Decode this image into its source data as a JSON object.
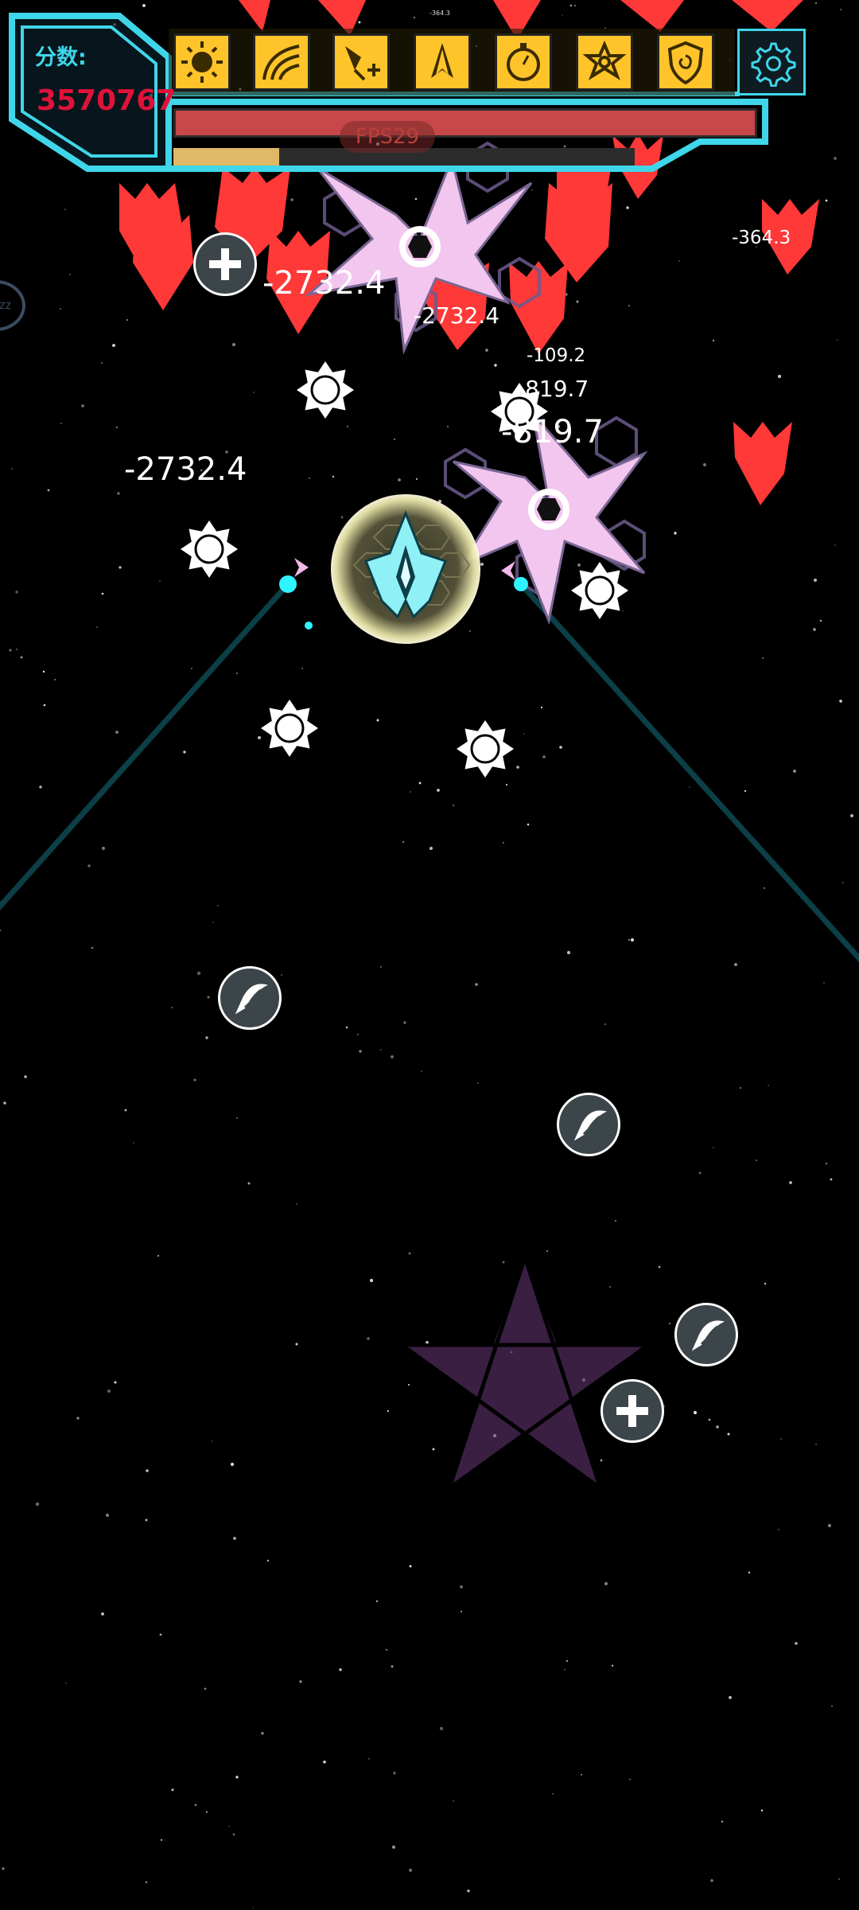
{
  "hud": {
    "score_label": "分数:",
    "score_value": "3570767",
    "fps_label": "FPS29",
    "xp_progress": 0.23,
    "skills": [
      {
        "icon": "sun-icon"
      },
      {
        "icon": "radar-sweep-icon"
      },
      {
        "icon": "drone-plus-icon"
      },
      {
        "icon": "jet-icon"
      },
      {
        "icon": "stopwatch-icon"
      },
      {
        "icon": "flower-icon"
      },
      {
        "icon": "spiral-shield-icon"
      }
    ],
    "settings_icon": "gear-icon"
  },
  "damage_numbers": [
    {
      "text": "-2732.4",
      "size": "big"
    },
    {
      "text": "-2732.4",
      "size": "normal"
    },
    {
      "text": "-2732.4",
      "size": "big"
    },
    {
      "text": "-109.2",
      "size": "small"
    },
    {
      "text": "-819.7",
      "size": "normal"
    },
    {
      "text": "-819.7",
      "size": "big"
    },
    {
      "text": "-364.3",
      "size": "small"
    }
  ],
  "tiny_text": [
    "-364.3"
  ],
  "side_button": {
    "label": "zz"
  },
  "pickups": [
    {
      "type": "heal",
      "icon": "plus-icon"
    },
    {
      "type": "boost",
      "icon": "rocket-icon"
    },
    {
      "type": "boost",
      "icon": "rocket-icon"
    },
    {
      "type": "boost",
      "icon": "rocket-icon"
    },
    {
      "type": "heal",
      "icon": "plus-icon"
    }
  ],
  "colors": {
    "hud_cyan": "#3fd6ea",
    "score_red": "#e0123a",
    "skill_gold": "#ffc42a",
    "hp_red": "#c8474a",
    "xp_gold": "#e1b867",
    "enemy_red": "#ff3838",
    "shuriken_pink": "#f2c6ee"
  }
}
